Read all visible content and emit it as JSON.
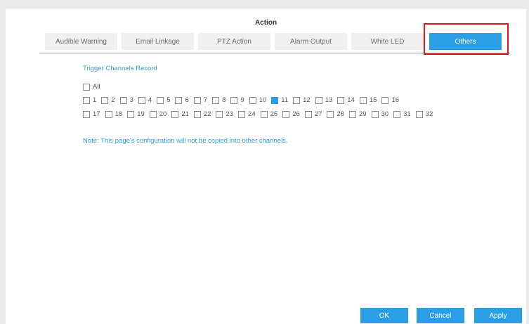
{
  "dialog": {
    "title": "Action"
  },
  "tabs": [
    {
      "label": "Audible Warning",
      "active": false
    },
    {
      "label": "Email Linkage",
      "active": false
    },
    {
      "label": "PTZ Action",
      "active": false
    },
    {
      "label": "Alarm Output",
      "active": false
    },
    {
      "label": "White LED",
      "active": false
    },
    {
      "label": "Others",
      "active": true
    }
  ],
  "section": {
    "title": "Trigger Channels Record"
  },
  "all_checkbox": {
    "label": "All",
    "checked": false
  },
  "channels": [
    {
      "label": "1",
      "checked": false
    },
    {
      "label": "2",
      "checked": false
    },
    {
      "label": "3",
      "checked": false
    },
    {
      "label": "4",
      "checked": false
    },
    {
      "label": "5",
      "checked": false
    },
    {
      "label": "6",
      "checked": false
    },
    {
      "label": "7",
      "checked": false
    },
    {
      "label": "8",
      "checked": false
    },
    {
      "label": "9",
      "checked": false
    },
    {
      "label": "10",
      "checked": false
    },
    {
      "label": "11",
      "checked": true
    },
    {
      "label": "12",
      "checked": false
    },
    {
      "label": "13",
      "checked": false
    },
    {
      "label": "14",
      "checked": false
    },
    {
      "label": "15",
      "checked": false
    },
    {
      "label": "16",
      "checked": false
    },
    {
      "label": "17",
      "checked": false
    },
    {
      "label": "18",
      "checked": false
    },
    {
      "label": "19",
      "checked": false
    },
    {
      "label": "20",
      "checked": false
    },
    {
      "label": "21",
      "checked": false
    },
    {
      "label": "22",
      "checked": false
    },
    {
      "label": "23",
      "checked": false
    },
    {
      "label": "24",
      "checked": false
    },
    {
      "label": "25",
      "checked": false
    },
    {
      "label": "26",
      "checked": false
    },
    {
      "label": "27",
      "checked": false
    },
    {
      "label": "28",
      "checked": false
    },
    {
      "label": "29",
      "checked": false
    },
    {
      "label": "30",
      "checked": false
    },
    {
      "label": "31",
      "checked": false
    },
    {
      "label": "32",
      "checked": false
    }
  ],
  "note": "Note: This page's configuration will not be copied into other channels.",
  "buttons": {
    "ok": "OK",
    "cancel": "Cancel",
    "apply": "Apply"
  },
  "colors": {
    "accent": "#2b9fe6",
    "highlight_border": "#e01616"
  }
}
